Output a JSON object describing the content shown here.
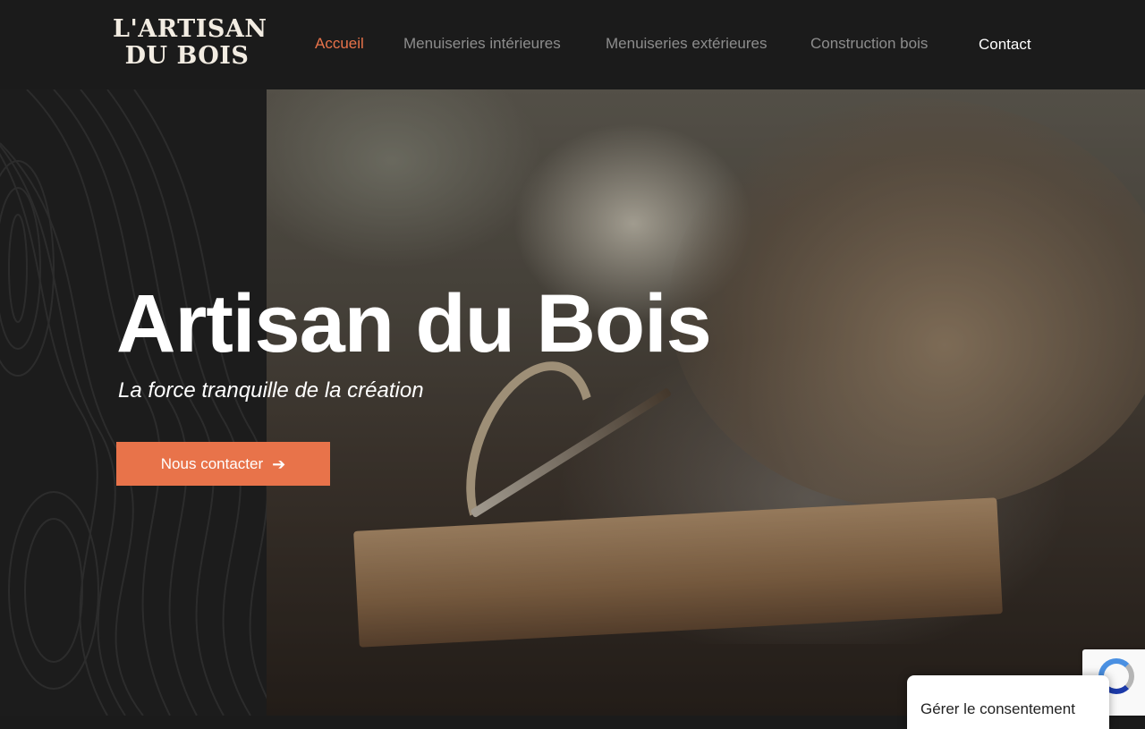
{
  "header": {
    "logo": {
      "line1": "L'ARTISAN",
      "line2": "DU BOIS"
    },
    "nav": [
      {
        "label": "Accueil",
        "active": true
      },
      {
        "label": "Menuiseries intérieures",
        "active": false
      },
      {
        "label": "Menuiseries extérieures",
        "active": false
      },
      {
        "label": "Construction bois",
        "active": false
      }
    ],
    "contact": "Contact"
  },
  "hero": {
    "title": "Artisan du Bois",
    "subtitle": "La force tranquille de la création",
    "cta_label": "Nous contacter",
    "cta_icon": "arrow-right-icon"
  },
  "consent": {
    "label": "Gérer le consentement"
  },
  "colors": {
    "accent": "#e8734a",
    "background": "#1b1b1b",
    "nav_text": "#8d8d8d"
  }
}
